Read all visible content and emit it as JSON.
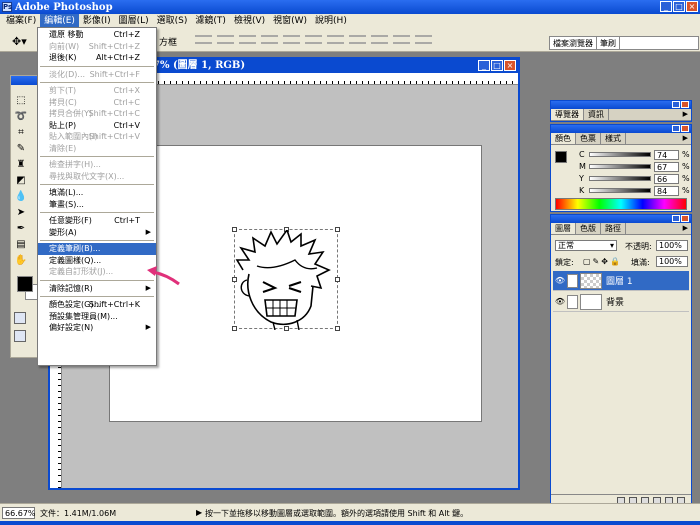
{
  "app": {
    "title": "Adobe Photoshop",
    "icon_letter": "Ps"
  },
  "menubar": {
    "items": [
      {
        "label": "檔案(F)"
      },
      {
        "label": "編輯(E)"
      },
      {
        "label": "影像(I)"
      },
      {
        "label": "圖層(L)"
      },
      {
        "label": "選取(S)"
      },
      {
        "label": "濾鏡(T)"
      },
      {
        "label": "檢視(V)"
      },
      {
        "label": "視窗(W)"
      },
      {
        "label": "說明(H)"
      }
    ]
  },
  "options_bar": {
    "tool_icon": "move-tool-icon",
    "label": "方框"
  },
  "palette_well": {
    "tabs": [
      "檔案瀏覽器",
      "筆刷"
    ]
  },
  "document": {
    "title": "7% (圖層 1, RGB)"
  },
  "edit_menu": {
    "items": [
      {
        "label": "還原 移動",
        "shortcut": "Ctrl+Z",
        "disabled": false
      },
      {
        "label": "向前(W)",
        "shortcut": "Shift+Ctrl+Z",
        "disabled": true
      },
      {
        "label": "退後(K)",
        "shortcut": "Alt+Ctrl+Z",
        "disabled": false
      },
      {
        "sep": true
      },
      {
        "label": "淡化(D)...",
        "shortcut": "Shift+Ctrl+F",
        "disabled": true
      },
      {
        "sep": true
      },
      {
        "label": "剪下(T)",
        "shortcut": "Ctrl+X",
        "disabled": true
      },
      {
        "label": "拷貝(C)",
        "shortcut": "Ctrl+C",
        "disabled": true
      },
      {
        "label": "拷貝合併(Y)",
        "shortcut": "Shift+Ctrl+C",
        "disabled": true
      },
      {
        "label": "貼上(P)",
        "shortcut": "Ctrl+V",
        "disabled": false
      },
      {
        "label": "貼入範圍內(I)",
        "shortcut": "Shift+Ctrl+V",
        "disabled": true
      },
      {
        "label": "清除(E)",
        "shortcut": "",
        "disabled": true
      },
      {
        "sep": true
      },
      {
        "label": "檢查拼字(H)...",
        "shortcut": "",
        "disabled": true
      },
      {
        "label": "尋找與取代文字(X)...",
        "shortcut": "",
        "disabled": true
      },
      {
        "sep": true
      },
      {
        "label": "填滿(L)...",
        "shortcut": "",
        "disabled": false
      },
      {
        "label": "筆畫(S)...",
        "shortcut": "",
        "disabled": false
      },
      {
        "sep": true
      },
      {
        "label": "任意變形(F)",
        "shortcut": "Ctrl+T",
        "disabled": false
      },
      {
        "label": "變形(A)",
        "shortcut": "",
        "disabled": false,
        "submenu": true
      },
      {
        "sep": true
      },
      {
        "label": "定義筆刷(B)...",
        "shortcut": "",
        "disabled": false,
        "highlighted": true
      },
      {
        "label": "定義圖樣(Q)...",
        "shortcut": "",
        "disabled": false
      },
      {
        "label": "定義自訂形狀(J)...",
        "shortcut": "",
        "disabled": true
      },
      {
        "sep": true
      },
      {
        "label": "清除記憶(R)",
        "shortcut": "",
        "disabled": false,
        "submenu": true
      },
      {
        "sep": true
      },
      {
        "label": "顏色設定(G)...",
        "shortcut": "Shift+Ctrl+K",
        "disabled": false
      },
      {
        "label": "預設集管理員(M)...",
        "shortcut": "",
        "disabled": false
      },
      {
        "label": "偏好設定(N)",
        "shortcut": "",
        "disabled": false,
        "submenu": true
      }
    ]
  },
  "navigator_palette": {
    "tabs": [
      "導覽器",
      "資訊"
    ]
  },
  "color_palette": {
    "tabs": [
      "顏色",
      "色票",
      "樣式"
    ],
    "channels": [
      {
        "label": "C",
        "value": "74",
        "unit": "%"
      },
      {
        "label": "M",
        "value": "67",
        "unit": "%"
      },
      {
        "label": "Y",
        "value": "66",
        "unit": "%"
      },
      {
        "label": "K",
        "value": "84",
        "unit": "%"
      }
    ]
  },
  "layers_palette": {
    "tabs": [
      "圖層",
      "色版",
      "路徑"
    ],
    "blend_mode": "正常",
    "opacity_label": "不透明:",
    "opacity": "100%",
    "lock_label": "鎖定:",
    "fill_label": "填滿:",
    "fill": "100%",
    "layers": [
      {
        "name": "圖層 1",
        "active": true
      },
      {
        "name": "背景",
        "active": false
      }
    ]
  },
  "status_bar": {
    "zoom": "66.67%",
    "doc_info": "文件：1.41M/1.06M",
    "message": "按一下並拖移以移動圖層或選取範圍。額外的選項請使用 Shift 和 Alt 鍵。"
  }
}
